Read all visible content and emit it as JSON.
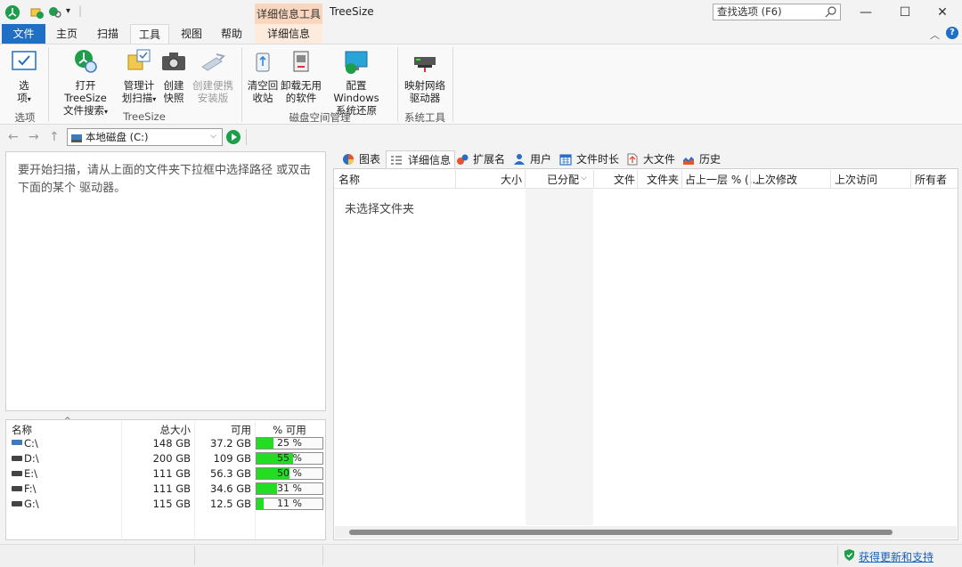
{
  "titlebar": {
    "context_tab": "详细信息工具",
    "app_name": "TreeSize",
    "search_placeholder": "查找选项 (F6)",
    "qa_dropdown": "▾",
    "qa_sep": "|",
    "min": "—",
    "max": "☐",
    "close": "✕"
  },
  "tabs": {
    "file": "文件",
    "home": "主页",
    "scan": "扫描",
    "tools": "工具",
    "view": "视图",
    "help": "帮助",
    "details": "详细信息"
  },
  "ribbon": {
    "options_btn_l1": "选",
    "options_btn_l2": "项",
    "options_btn_caret": "▾",
    "group_options": "选项",
    "open_l1": "打开 TreeSize",
    "open_l2": "文件搜索",
    "open_caret": "▾",
    "schedule_l1": "管理计",
    "schedule_l2": "划扫描",
    "schedule_caret": "▾",
    "snapshot_l1": "创建",
    "snapshot_l2": "快照",
    "portable_l1": "创建便携",
    "portable_l2": "安装版",
    "group_treesize": "TreeSize",
    "recycle_l1": "清空回",
    "recycle_l2": "收站",
    "uninstall_l1": "卸载无用",
    "uninstall_l2": "的软件",
    "restore_l1": "配置 Windows",
    "restore_l2": "系统还原",
    "group_disk": "磁盘空间管理",
    "map_l1": "映射网络",
    "map_l2": "驱动器",
    "group_sys": "系统工具"
  },
  "address": {
    "value": "本地磁盘 (C:)",
    "dropdown": "⌵",
    "back": "←",
    "forward": "→",
    "up": "↑"
  },
  "left": {
    "hint": "要开始扫描，请从上面的文件夹下拉框中选择路径 或双击下面的某个 驱动器。"
  },
  "drives": {
    "headers": {
      "name": "名称",
      "total": "总大小",
      "free": "可用",
      "pct": "% 可用",
      "sort": "^"
    },
    "rows": [
      {
        "name": "C:\\",
        "total": "148 GB",
        "free": "37.2 GB",
        "pct": "25 %",
        "fill": 25
      },
      {
        "name": "D:\\",
        "total": "200 GB",
        "free": "109 GB",
        "pct": "55 %",
        "fill": 55
      },
      {
        "name": "E:\\",
        "total": "111 GB",
        "free": "56.3 GB",
        "pct": "50 %",
        "fill": 50
      },
      {
        "name": "F:\\",
        "total": "111 GB",
        "free": "34.6 GB",
        "pct": "31 %",
        "fill": 31
      },
      {
        "name": "G:\\",
        "total": "115 GB",
        "free": "12.5 GB",
        "pct": "11 %",
        "fill": 11
      }
    ]
  },
  "right": {
    "tabs": {
      "chart": "图表",
      "details": "详细信息",
      "ext": "扩展名",
      "users": "用户",
      "age": "文件时长",
      "large": "大文件",
      "history": "历史"
    },
    "headers": {
      "name": "名称",
      "size": "大小",
      "allocated": "已分配",
      "files": "文件",
      "folders": "文件夹",
      "parent": "占上一层 % (...",
      "modified": "上次修改",
      "accessed": "上次访问",
      "owner": "所有者",
      "sort_caret": "⌵"
    },
    "empty": "未选择文件夹"
  },
  "status": {
    "update_link": "获得更新和支持"
  },
  "colors": {
    "accent": "#1f6fc5",
    "context_tab": "#f9d6bd",
    "pct_fill": "#22dd22",
    "brand_green": "#1e9e4a"
  }
}
